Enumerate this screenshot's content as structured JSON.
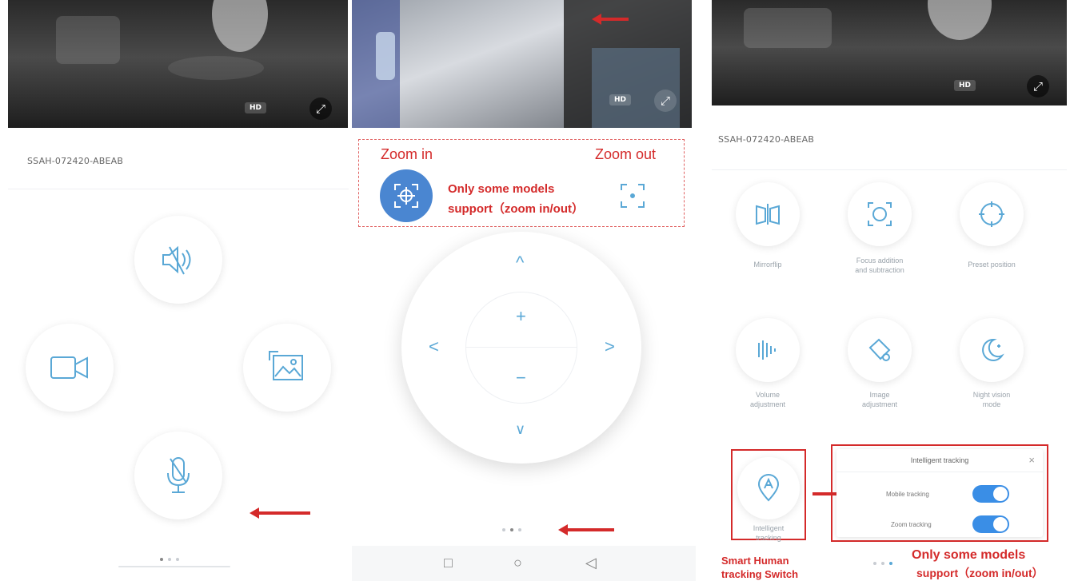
{
  "left_panel": {
    "device_name": "SSAH-072420-ABEAB",
    "hd_label": "HD",
    "controls": {
      "mute": "speaker-mute-icon",
      "record": "video-camera-icon",
      "screenshot": "picture-icon",
      "talk": "microphone-icon"
    }
  },
  "middle_panel": {
    "hd_label": "HD",
    "zoom_in_label": "Zoom in",
    "zoom_out_label": "Zoom out",
    "note_line1": "Only some models",
    "note_line2": "support（zoom in/out）",
    "ptz": {
      "up": "^",
      "down": "∨",
      "left": "<",
      "right": ">",
      "plus": "+",
      "minus": "−"
    },
    "nav": {
      "recent": "□",
      "home": "○",
      "back": "◁"
    }
  },
  "right_panel": {
    "device_name": "SSAH-072420-ABEAB",
    "hd_label": "HD",
    "features": [
      {
        "label": "Mirrorflip",
        "icon": "mirror-flip-icon"
      },
      {
        "label": "Focus addition\nand subtraction",
        "icon": "focus-icon"
      },
      {
        "label": "Preset position",
        "icon": "preset-position-icon"
      },
      {
        "label": "Volume\nadjustment",
        "icon": "volume-icon"
      },
      {
        "label": "Image\nadjustment",
        "icon": "image-adjust-icon"
      },
      {
        "label": "Night vision\nmode",
        "icon": "night-vision-icon"
      }
    ],
    "tracking": {
      "button_label": "Intelligent\ntracking",
      "popup_title": "Intelligent tracking",
      "close": "×",
      "mobile_tracking": "Mobile tracking",
      "zoom_tracking": "Zoom tracking"
    },
    "annot_switch_line1": "Smart Human",
    "annot_switch_line2": "tracking Switch",
    "annot_note_line1": "Only some models",
    "annot_note_line2": "support（zoom in/out）"
  },
  "colors": {
    "accent": "#5aa8d6",
    "toggle_on": "#3a8ee6",
    "annotation_red": "#d42a2a"
  }
}
